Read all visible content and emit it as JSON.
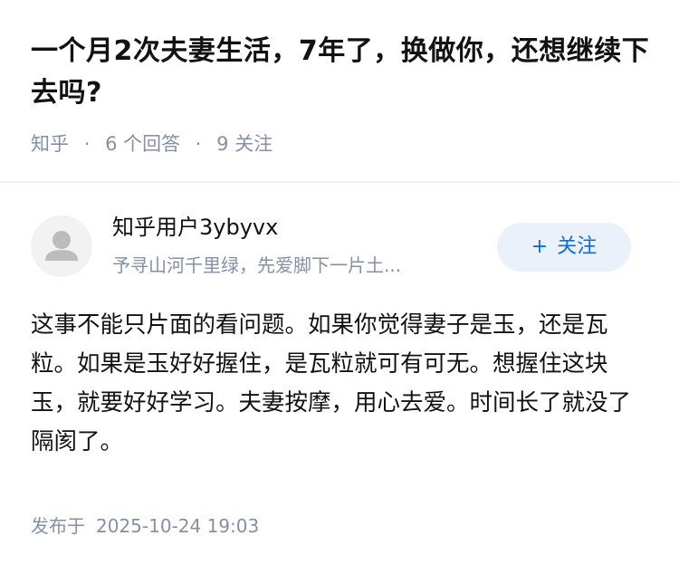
{
  "question": {
    "title": "一个月2次夫妻生活，7年了，换做你，还想继续下去吗?",
    "source": "知乎",
    "separator": "·",
    "answer_count": "6 个回答",
    "follower_count": "9 关注"
  },
  "answer": {
    "author": {
      "name": "知乎用户3ybyvx",
      "bio": "予寻山河千里绿，先爱脚下一片土...",
      "avatar_icon": "default-user-avatar-icon"
    },
    "follow_button": {
      "icon": "plus-icon",
      "plus": "+",
      "label": "关注"
    },
    "content": "这事不能只片面的看问题。如果你觉得妻子是玉，还是瓦粒。如果是玉好好握住，是瓦粒就可有可无。想握住这块玉，就要好好学习。夫妻按摩，用心去爱。时间长了就没了隔阂了。",
    "published_label": "发布于",
    "published_time": "2025-10-24 19:03"
  },
  "colors": {
    "primary_text": "#121212",
    "secondary_text": "#8590a6",
    "accent_blue": "#056de8",
    "follow_bg": "#eaf1fb",
    "divider": "#f0f2f5"
  }
}
